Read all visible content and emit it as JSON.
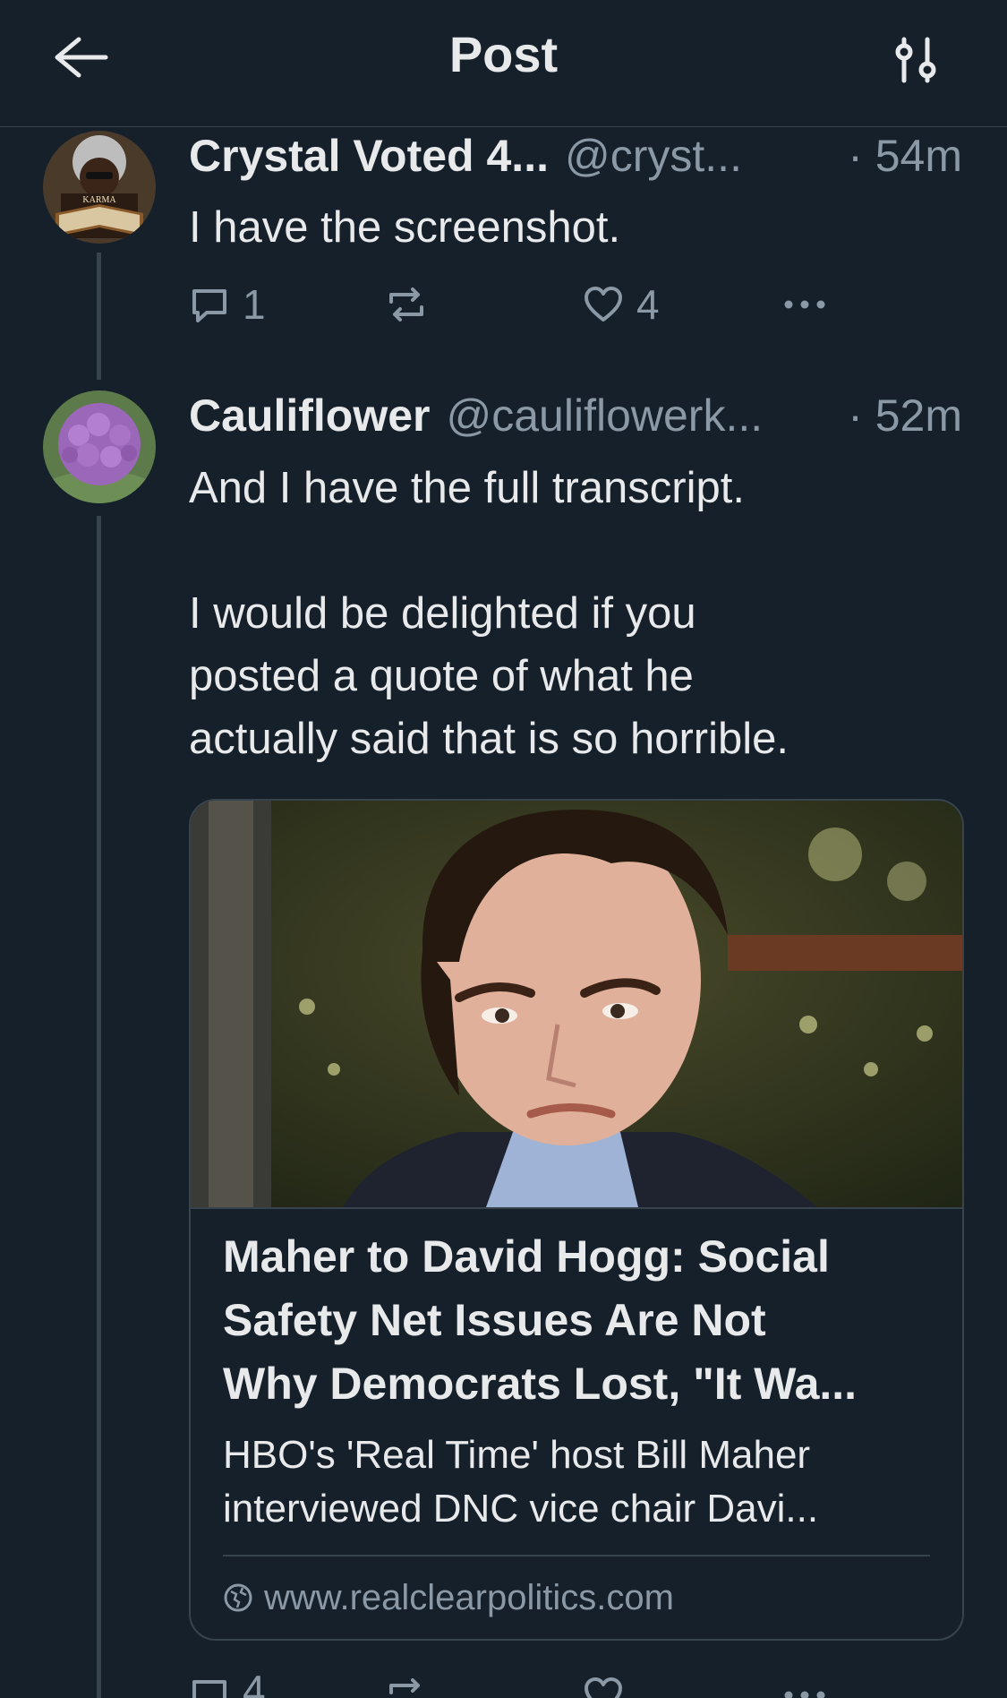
{
  "header": {
    "title": "Post",
    "back_icon": "back-arrow-icon",
    "settings_icon": "settings-sliders-icon"
  },
  "tweets": [
    {
      "name": "Crystal Voted 4...",
      "handle": "@cryst...",
      "time": "· 54m",
      "text": "I have the screenshot.",
      "replies": "1",
      "retweets": "",
      "likes": "4"
    },
    {
      "name": "Cauliflower",
      "handle": "@cauliflowerk...",
      "time": "· 52m",
      "text_lines": [
        "And I have the full transcript.",
        "",
        "I would be delighted if you",
        "posted a quote of what he",
        "actually said that is so horrible."
      ],
      "card": {
        "title_lines": [
          "Maher to David Hogg: Social",
          "Safety Net Issues Are Not",
          "Why Democrats Lost, \"It Wa..."
        ],
        "desc_lines": [
          "HBO's 'Real Time' host Bill Maher",
          "interviewed DNC vice chair Davi..."
        ],
        "domain": "www.realclearpolitics.com"
      },
      "replies": "4"
    }
  ],
  "avatar_badge_text": "KARMA",
  "colors": {
    "background": "#15202b",
    "text": "#e7e9ea",
    "secondary": "#8b98a5",
    "border": "#38444d"
  }
}
